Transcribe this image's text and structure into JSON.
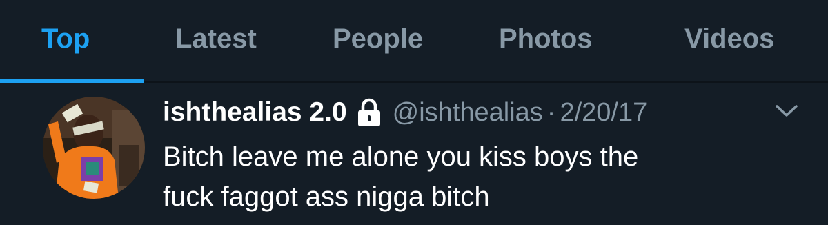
{
  "tabs": [
    {
      "label": "Top",
      "active": true
    },
    {
      "label": "Latest",
      "active": false
    },
    {
      "label": "People",
      "active": false
    },
    {
      "label": "Photos",
      "active": false
    },
    {
      "label": "Videos",
      "active": false
    }
  ],
  "tweet": {
    "display_name": "ishthealias 2.0",
    "protected_icon": "lock-icon",
    "handle": "@ishthealias",
    "separator": "·",
    "timestamp": "2/20/17",
    "menu_icon": "chevron-down-icon",
    "text_line1": "Bitch leave me alone you kiss boys the",
    "text_line2": "fuck faggot ass nigga bitch"
  },
  "colors": {
    "background": "#141d26",
    "accent": "#1da1f2",
    "muted": "#8899a6",
    "text": "#ffffff"
  }
}
